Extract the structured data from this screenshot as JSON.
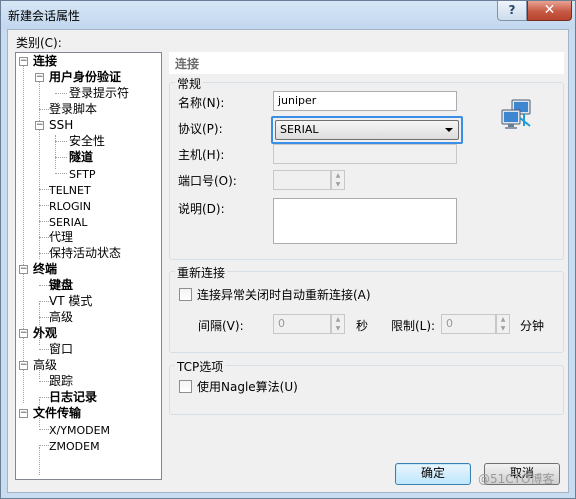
{
  "window": {
    "title": "新建会话属性",
    "help_label": "?",
    "close_label": "✕"
  },
  "category_label": "类别(C):",
  "tree": [
    {
      "label": "连接"
    },
    {
      "label": "用户身份验证"
    },
    {
      "label": "登录提示符"
    },
    {
      "label": "登录脚本"
    },
    {
      "label": "SSH"
    },
    {
      "label": "安全性"
    },
    {
      "label": "隧道"
    },
    {
      "label": "SFTP"
    },
    {
      "label": "TELNET"
    },
    {
      "label": "RLOGIN"
    },
    {
      "label": "SERIAL"
    },
    {
      "label": "代理"
    },
    {
      "label": "保持活动状态"
    },
    {
      "label": "终端"
    },
    {
      "label": "键盘"
    },
    {
      "label": "VT 模式"
    },
    {
      "label": "高级"
    },
    {
      "label": "外观"
    },
    {
      "label": "窗口"
    },
    {
      "label": "高级"
    },
    {
      "label": "跟踪"
    },
    {
      "label": "日志记录"
    },
    {
      "label": "文件传输"
    },
    {
      "label": "X/YMODEM"
    },
    {
      "label": "ZMODEM"
    }
  ],
  "panel": {
    "header": "连接",
    "general": {
      "title": "常规",
      "name_label": "名称(N):",
      "name_value": "juniper",
      "protocol_label": "协议(P):",
      "protocol_value": "SERIAL",
      "host_label": "主机(H):",
      "host_value": "",
      "port_label": "端口号(O):",
      "port_value": "",
      "desc_label": "说明(D):",
      "desc_value": "",
      "network_icon": "network-computers-icon"
    },
    "reconnect": {
      "title": "重新连接",
      "auto_label": "连接异常关闭时自动重新连接(A)",
      "interval_label": "间隔(V):",
      "interval_value": "0",
      "seconds_label": "秒",
      "limit_label": "限制(L):",
      "limit_value": "0",
      "minutes_label": "分钟"
    },
    "tcp": {
      "title": "TCP选项",
      "nagle_label": "使用Nagle算法(U)"
    }
  },
  "buttons": {
    "ok": "确定",
    "cancel": "取消"
  },
  "watermark": "@51CTO博客"
}
